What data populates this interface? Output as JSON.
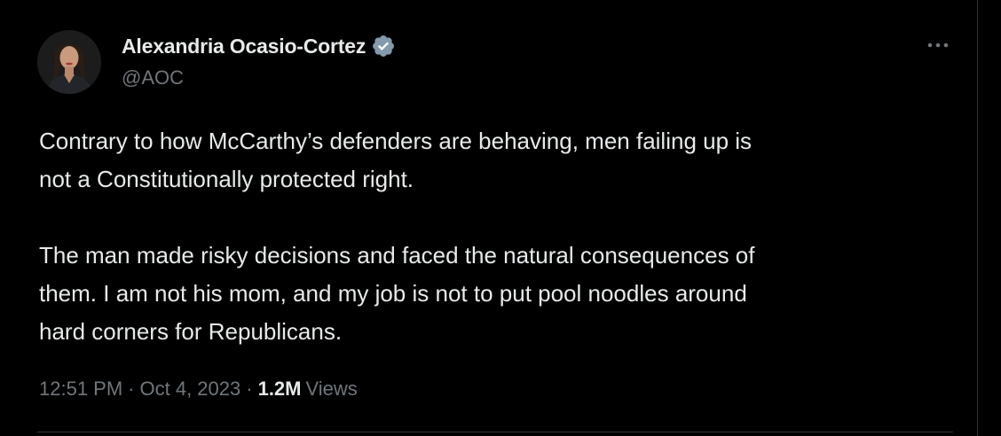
{
  "author": {
    "display_name": "Alexandria Ocasio-Cortez",
    "handle": "@AOC",
    "verified": true,
    "verified_color": "#829aab"
  },
  "more_icon": "more-horizontal-icon",
  "tweet": {
    "paragraphs": [
      [
        "Contrary to how McCarthy’s defenders are behaving, men failing up is",
        "not a Constitutionally protected right."
      ],
      [
        "The man made risky decisions and faced the natural consequences of",
        "them. I am not his mom, and my job is not to put pool noodles around",
        "hard corners for Republicans."
      ]
    ]
  },
  "meta": {
    "time": "12:51 PM",
    "separator": "·",
    "date": "Oct 4, 2023",
    "views_count": "1.2M",
    "views_label": "Views"
  },
  "colors": {
    "background": "#000000",
    "primary_text": "#e7e9ea",
    "secondary_text": "#71767b",
    "border": "#2f3336"
  }
}
